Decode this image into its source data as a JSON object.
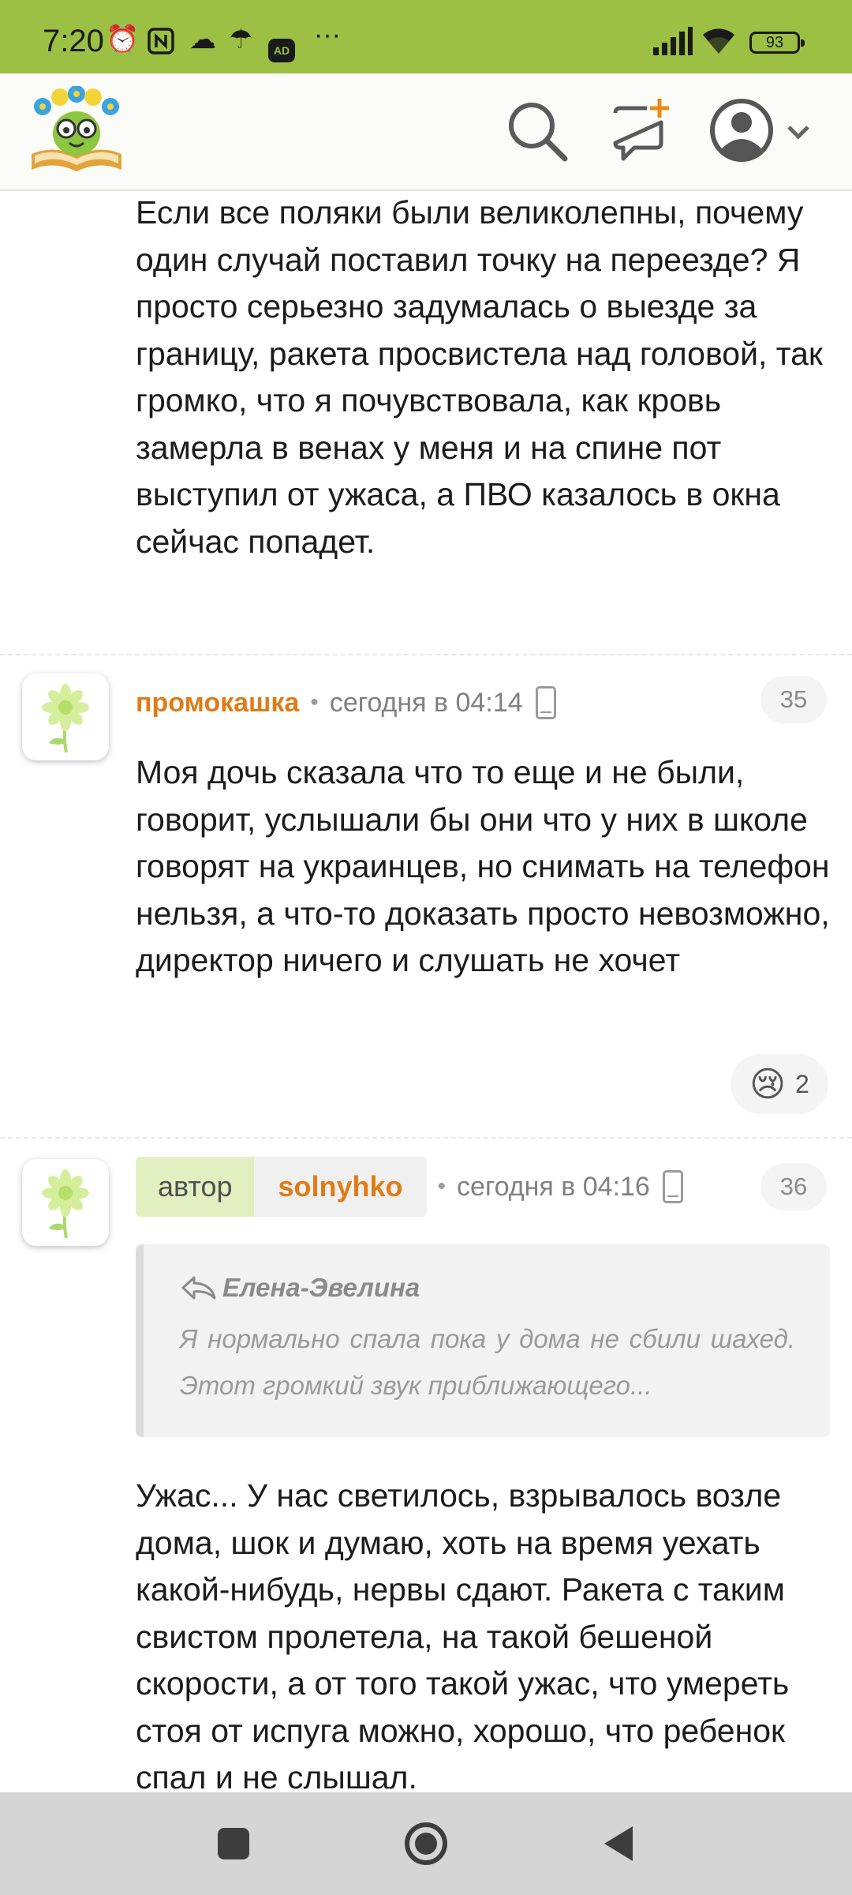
{
  "status_bar": {
    "time": "7:20",
    "battery": "93",
    "icons": [
      "alarm-icon",
      "nfc-icon",
      "cloud-icon",
      "umbrella-icon",
      "adblocker-icon",
      "more-dots-icon",
      "signal-icon",
      "wifi-icon",
      "battery-icon"
    ],
    "ad_label": "AD",
    "more": "···"
  },
  "header": {
    "logo": "site-logo",
    "actions": [
      "search-icon",
      "new-message-icon",
      "profile-menu"
    ]
  },
  "comments": [
    {
      "text": "Если все поляки были великолепны, почему один случай поставил точку на переезде? Я просто серьезно задумалась о выезде за границу, ракета просвистела над головой, так громко, что я почувствовала, как кровь замерла в венах у меня и на спине пот выступил от ужаса, а ПВО казалось в окна сейчас попадет."
    },
    {
      "author": "промокашка",
      "time": "сегодня в 04:14",
      "number": "35",
      "text": "Моя дочь сказала что то еще и не были, говорит, услышали бы они что у них в школе говорят на украинцев, но снимать на телефон нельзя, а что-то доказать просто невозможно, директор ничего и слушать не хочет",
      "reaction": {
        "emoji": "😢",
        "count": "2"
      }
    },
    {
      "badge": "автор",
      "author": "solnyhko",
      "time": "сегодня в 04:16",
      "number": "36",
      "quote": {
        "name": "Елена-Эвелина",
        "text": "Я нормально спала пока у дома не сбили шахед. Этот громкий звук приближающего..."
      },
      "text": "Ужас... У нас светилось, взрывалось возле дома, шок и думаю, хоть на время уехать какой-нибудь, нервы сдают. Ракета с таким свистом пролетела, на такой бешеной скорости, а от того такой ужас, что умереть стоя от испуга можно, хорошо, что ребенок спал и не слышал."
    }
  ],
  "nav": {
    "buttons": [
      "recents-button",
      "home-button",
      "back-button"
    ]
  }
}
